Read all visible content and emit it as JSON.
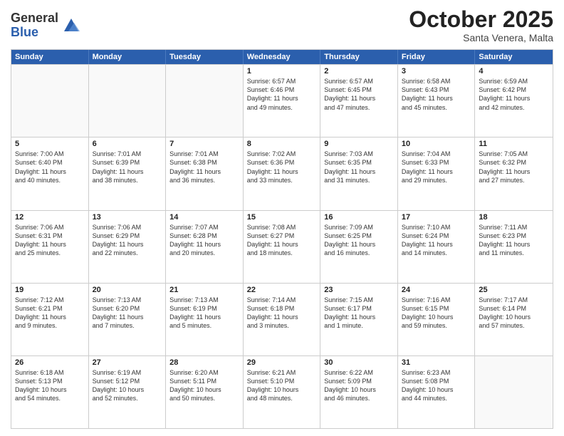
{
  "logo": {
    "general": "General",
    "blue": "Blue"
  },
  "title": "October 2025",
  "location": "Santa Venera, Malta",
  "days": [
    "Sunday",
    "Monday",
    "Tuesday",
    "Wednesday",
    "Thursday",
    "Friday",
    "Saturday"
  ],
  "rows": [
    [
      {
        "day": "",
        "info": ""
      },
      {
        "day": "",
        "info": ""
      },
      {
        "day": "",
        "info": ""
      },
      {
        "day": "1",
        "info": "Sunrise: 6:57 AM\nSunset: 6:46 PM\nDaylight: 11 hours\nand 49 minutes."
      },
      {
        "day": "2",
        "info": "Sunrise: 6:57 AM\nSunset: 6:45 PM\nDaylight: 11 hours\nand 47 minutes."
      },
      {
        "day": "3",
        "info": "Sunrise: 6:58 AM\nSunset: 6:43 PM\nDaylight: 11 hours\nand 45 minutes."
      },
      {
        "day": "4",
        "info": "Sunrise: 6:59 AM\nSunset: 6:42 PM\nDaylight: 11 hours\nand 42 minutes."
      }
    ],
    [
      {
        "day": "5",
        "info": "Sunrise: 7:00 AM\nSunset: 6:40 PM\nDaylight: 11 hours\nand 40 minutes."
      },
      {
        "day": "6",
        "info": "Sunrise: 7:01 AM\nSunset: 6:39 PM\nDaylight: 11 hours\nand 38 minutes."
      },
      {
        "day": "7",
        "info": "Sunrise: 7:01 AM\nSunset: 6:38 PM\nDaylight: 11 hours\nand 36 minutes."
      },
      {
        "day": "8",
        "info": "Sunrise: 7:02 AM\nSunset: 6:36 PM\nDaylight: 11 hours\nand 33 minutes."
      },
      {
        "day": "9",
        "info": "Sunrise: 7:03 AM\nSunset: 6:35 PM\nDaylight: 11 hours\nand 31 minutes."
      },
      {
        "day": "10",
        "info": "Sunrise: 7:04 AM\nSunset: 6:33 PM\nDaylight: 11 hours\nand 29 minutes."
      },
      {
        "day": "11",
        "info": "Sunrise: 7:05 AM\nSunset: 6:32 PM\nDaylight: 11 hours\nand 27 minutes."
      }
    ],
    [
      {
        "day": "12",
        "info": "Sunrise: 7:06 AM\nSunset: 6:31 PM\nDaylight: 11 hours\nand 25 minutes."
      },
      {
        "day": "13",
        "info": "Sunrise: 7:06 AM\nSunset: 6:29 PM\nDaylight: 11 hours\nand 22 minutes."
      },
      {
        "day": "14",
        "info": "Sunrise: 7:07 AM\nSunset: 6:28 PM\nDaylight: 11 hours\nand 20 minutes."
      },
      {
        "day": "15",
        "info": "Sunrise: 7:08 AM\nSunset: 6:27 PM\nDaylight: 11 hours\nand 18 minutes."
      },
      {
        "day": "16",
        "info": "Sunrise: 7:09 AM\nSunset: 6:25 PM\nDaylight: 11 hours\nand 16 minutes."
      },
      {
        "day": "17",
        "info": "Sunrise: 7:10 AM\nSunset: 6:24 PM\nDaylight: 11 hours\nand 14 minutes."
      },
      {
        "day": "18",
        "info": "Sunrise: 7:11 AM\nSunset: 6:23 PM\nDaylight: 11 hours\nand 11 minutes."
      }
    ],
    [
      {
        "day": "19",
        "info": "Sunrise: 7:12 AM\nSunset: 6:21 PM\nDaylight: 11 hours\nand 9 minutes."
      },
      {
        "day": "20",
        "info": "Sunrise: 7:13 AM\nSunset: 6:20 PM\nDaylight: 11 hours\nand 7 minutes."
      },
      {
        "day": "21",
        "info": "Sunrise: 7:13 AM\nSunset: 6:19 PM\nDaylight: 11 hours\nand 5 minutes."
      },
      {
        "day": "22",
        "info": "Sunrise: 7:14 AM\nSunset: 6:18 PM\nDaylight: 11 hours\nand 3 minutes."
      },
      {
        "day": "23",
        "info": "Sunrise: 7:15 AM\nSunset: 6:17 PM\nDaylight: 11 hours\nand 1 minute."
      },
      {
        "day": "24",
        "info": "Sunrise: 7:16 AM\nSunset: 6:15 PM\nDaylight: 10 hours\nand 59 minutes."
      },
      {
        "day": "25",
        "info": "Sunrise: 7:17 AM\nSunset: 6:14 PM\nDaylight: 10 hours\nand 57 minutes."
      }
    ],
    [
      {
        "day": "26",
        "info": "Sunrise: 6:18 AM\nSunset: 5:13 PM\nDaylight: 10 hours\nand 54 minutes."
      },
      {
        "day": "27",
        "info": "Sunrise: 6:19 AM\nSunset: 5:12 PM\nDaylight: 10 hours\nand 52 minutes."
      },
      {
        "day": "28",
        "info": "Sunrise: 6:20 AM\nSunset: 5:11 PM\nDaylight: 10 hours\nand 50 minutes."
      },
      {
        "day": "29",
        "info": "Sunrise: 6:21 AM\nSunset: 5:10 PM\nDaylight: 10 hours\nand 48 minutes."
      },
      {
        "day": "30",
        "info": "Sunrise: 6:22 AM\nSunset: 5:09 PM\nDaylight: 10 hours\nand 46 minutes."
      },
      {
        "day": "31",
        "info": "Sunrise: 6:23 AM\nSunset: 5:08 PM\nDaylight: 10 hours\nand 44 minutes."
      },
      {
        "day": "",
        "info": ""
      }
    ]
  ]
}
